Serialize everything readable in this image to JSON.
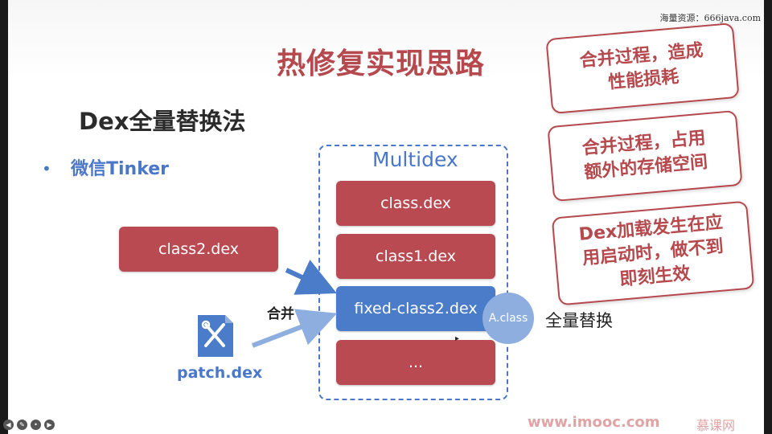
{
  "watermark": "海量资源：666java.com",
  "title": "热修复实现思路",
  "subtitle": "Dex全量替换法",
  "bullet": {
    "marker": "•",
    "text": "微信Tinker"
  },
  "multidex": {
    "label": "Multidex",
    "items": [
      "class.dex",
      "class1.dex",
      "fixed-class2.dex",
      "..."
    ]
  },
  "class2": "class2.dex",
  "merge_label": "合并",
  "patch_label": "patch.dex",
  "aclass": "A.class",
  "full_replace": "全量替换",
  "notes": [
    {
      "line1": "合并过程，造成",
      "line2": "性能损耗",
      "line3": ""
    },
    {
      "line1": "合并过程，占用",
      "line2": "额外的存储空间",
      "line3": ""
    },
    {
      "line1": "Dex加载发生在应",
      "line2": "用启动时，做不到",
      "line3": "即刻生效"
    }
  ],
  "footer": {
    "url": "www.imooc.com",
    "logo": "慕课网"
  },
  "colors": {
    "red": "#b94a52",
    "blue": "#4a7cc9",
    "light_blue": "#8eaee0"
  },
  "icons": [
    "tools-icon",
    "arrow-icon",
    "cursor-icon"
  ]
}
